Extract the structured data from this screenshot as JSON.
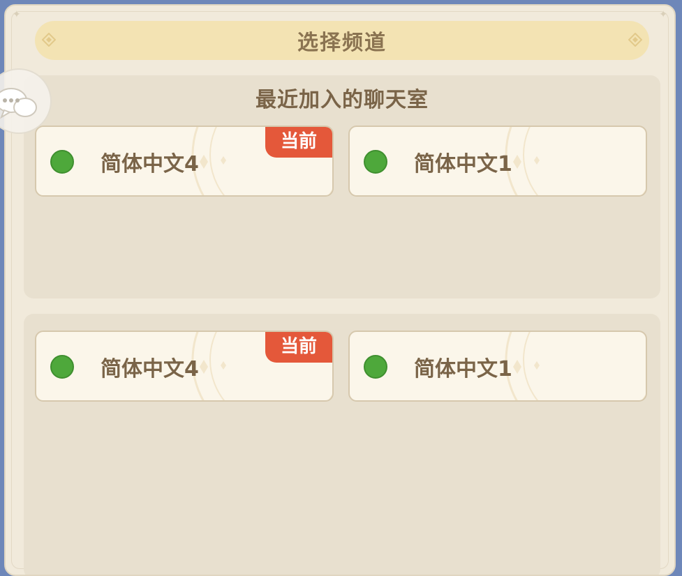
{
  "header": {
    "title": "选择频道"
  },
  "recent": {
    "title": "最近加入的聊天室",
    "channels": [
      {
        "name": "简体中文4",
        "badge": "当前"
      },
      {
        "name": "简体中文1",
        "badge": ""
      }
    ]
  },
  "all": {
    "channels": [
      {
        "name": "简体中文4",
        "badge": "当前"
      },
      {
        "name": "简体中文1",
        "badge": ""
      }
    ]
  },
  "colors": {
    "background": "#6e87b9",
    "panel": "#f1eadb",
    "header": "#f3e3b3",
    "section": "#e8e0cf",
    "card": "#fbf6ea",
    "text": "#7a6448",
    "online_dot": "#4ea83b",
    "badge": "#e4583a"
  },
  "icons": {
    "chat": "chat-bubble-icon",
    "online": "online-status-icon",
    "diamond": "diamond-ornament-icon"
  }
}
